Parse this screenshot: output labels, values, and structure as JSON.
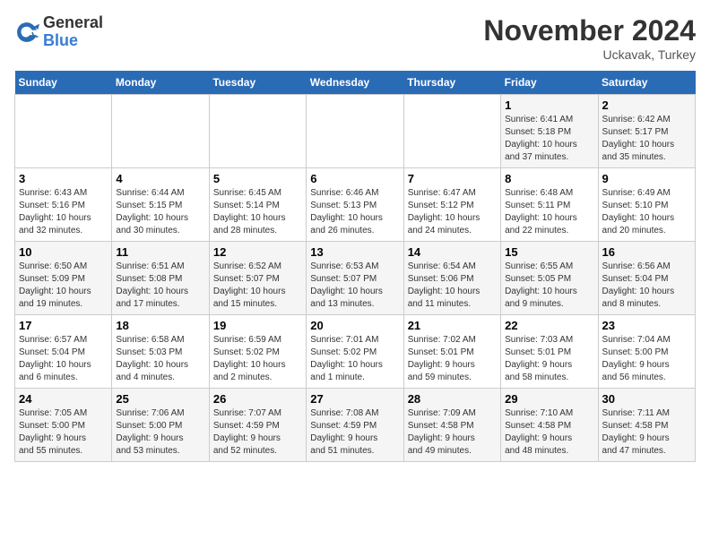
{
  "logo": {
    "general": "General",
    "blue": "Blue"
  },
  "title": "November 2024",
  "location": "Uckavak, Turkey",
  "days_of_week": [
    "Sunday",
    "Monday",
    "Tuesday",
    "Wednesday",
    "Thursday",
    "Friday",
    "Saturday"
  ],
  "weeks": [
    [
      {
        "day": "",
        "info": ""
      },
      {
        "day": "",
        "info": ""
      },
      {
        "day": "",
        "info": ""
      },
      {
        "day": "",
        "info": ""
      },
      {
        "day": "",
        "info": ""
      },
      {
        "day": "1",
        "info": "Sunrise: 6:41 AM\nSunset: 5:18 PM\nDaylight: 10 hours\nand 37 minutes."
      },
      {
        "day": "2",
        "info": "Sunrise: 6:42 AM\nSunset: 5:17 PM\nDaylight: 10 hours\nand 35 minutes."
      }
    ],
    [
      {
        "day": "3",
        "info": "Sunrise: 6:43 AM\nSunset: 5:16 PM\nDaylight: 10 hours\nand 32 minutes."
      },
      {
        "day": "4",
        "info": "Sunrise: 6:44 AM\nSunset: 5:15 PM\nDaylight: 10 hours\nand 30 minutes."
      },
      {
        "day": "5",
        "info": "Sunrise: 6:45 AM\nSunset: 5:14 PM\nDaylight: 10 hours\nand 28 minutes."
      },
      {
        "day": "6",
        "info": "Sunrise: 6:46 AM\nSunset: 5:13 PM\nDaylight: 10 hours\nand 26 minutes."
      },
      {
        "day": "7",
        "info": "Sunrise: 6:47 AM\nSunset: 5:12 PM\nDaylight: 10 hours\nand 24 minutes."
      },
      {
        "day": "8",
        "info": "Sunrise: 6:48 AM\nSunset: 5:11 PM\nDaylight: 10 hours\nand 22 minutes."
      },
      {
        "day": "9",
        "info": "Sunrise: 6:49 AM\nSunset: 5:10 PM\nDaylight: 10 hours\nand 20 minutes."
      }
    ],
    [
      {
        "day": "10",
        "info": "Sunrise: 6:50 AM\nSunset: 5:09 PM\nDaylight: 10 hours\nand 19 minutes."
      },
      {
        "day": "11",
        "info": "Sunrise: 6:51 AM\nSunset: 5:08 PM\nDaylight: 10 hours\nand 17 minutes."
      },
      {
        "day": "12",
        "info": "Sunrise: 6:52 AM\nSunset: 5:07 PM\nDaylight: 10 hours\nand 15 minutes."
      },
      {
        "day": "13",
        "info": "Sunrise: 6:53 AM\nSunset: 5:07 PM\nDaylight: 10 hours\nand 13 minutes."
      },
      {
        "day": "14",
        "info": "Sunrise: 6:54 AM\nSunset: 5:06 PM\nDaylight: 10 hours\nand 11 minutes."
      },
      {
        "day": "15",
        "info": "Sunrise: 6:55 AM\nSunset: 5:05 PM\nDaylight: 10 hours\nand 9 minutes."
      },
      {
        "day": "16",
        "info": "Sunrise: 6:56 AM\nSunset: 5:04 PM\nDaylight: 10 hours\nand 8 minutes."
      }
    ],
    [
      {
        "day": "17",
        "info": "Sunrise: 6:57 AM\nSunset: 5:04 PM\nDaylight: 10 hours\nand 6 minutes."
      },
      {
        "day": "18",
        "info": "Sunrise: 6:58 AM\nSunset: 5:03 PM\nDaylight: 10 hours\nand 4 minutes."
      },
      {
        "day": "19",
        "info": "Sunrise: 6:59 AM\nSunset: 5:02 PM\nDaylight: 10 hours\nand 2 minutes."
      },
      {
        "day": "20",
        "info": "Sunrise: 7:01 AM\nSunset: 5:02 PM\nDaylight: 10 hours\nand 1 minute."
      },
      {
        "day": "21",
        "info": "Sunrise: 7:02 AM\nSunset: 5:01 PM\nDaylight: 9 hours\nand 59 minutes."
      },
      {
        "day": "22",
        "info": "Sunrise: 7:03 AM\nSunset: 5:01 PM\nDaylight: 9 hours\nand 58 minutes."
      },
      {
        "day": "23",
        "info": "Sunrise: 7:04 AM\nSunset: 5:00 PM\nDaylight: 9 hours\nand 56 minutes."
      }
    ],
    [
      {
        "day": "24",
        "info": "Sunrise: 7:05 AM\nSunset: 5:00 PM\nDaylight: 9 hours\nand 55 minutes."
      },
      {
        "day": "25",
        "info": "Sunrise: 7:06 AM\nSunset: 5:00 PM\nDaylight: 9 hours\nand 53 minutes."
      },
      {
        "day": "26",
        "info": "Sunrise: 7:07 AM\nSunset: 4:59 PM\nDaylight: 9 hours\nand 52 minutes."
      },
      {
        "day": "27",
        "info": "Sunrise: 7:08 AM\nSunset: 4:59 PM\nDaylight: 9 hours\nand 51 minutes."
      },
      {
        "day": "28",
        "info": "Sunrise: 7:09 AM\nSunset: 4:58 PM\nDaylight: 9 hours\nand 49 minutes."
      },
      {
        "day": "29",
        "info": "Sunrise: 7:10 AM\nSunset: 4:58 PM\nDaylight: 9 hours\nand 48 minutes."
      },
      {
        "day": "30",
        "info": "Sunrise: 7:11 AM\nSunset: 4:58 PM\nDaylight: 9 hours\nand 47 minutes."
      }
    ]
  ]
}
